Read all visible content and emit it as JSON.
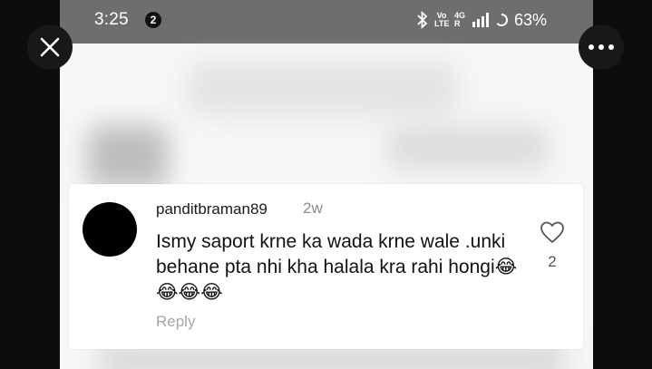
{
  "status_bar": {
    "time": "3:25",
    "notification_count": "2",
    "volte_label": "Vo LTE",
    "network_label": "4G R",
    "battery": "63%"
  },
  "comment": {
    "username": "panditbraman89",
    "time_ago": "2w",
    "text": "Ismy saport krne ka wada krne wale .unki behane pta nhi kha halala kra rahi hongi😂😂😂😂",
    "like_count": "2",
    "reply_label": "Reply"
  },
  "icons": {
    "close": "close-icon",
    "more": "more-options-icon",
    "like": "heart-icon"
  },
  "colors": {
    "status_bar_bg": "#6e6e6e",
    "overlay_bg": "#0d0d0d",
    "card_bg": "#ffffff",
    "avatar": "#000000",
    "muted_text": "#8a8a8a"
  }
}
